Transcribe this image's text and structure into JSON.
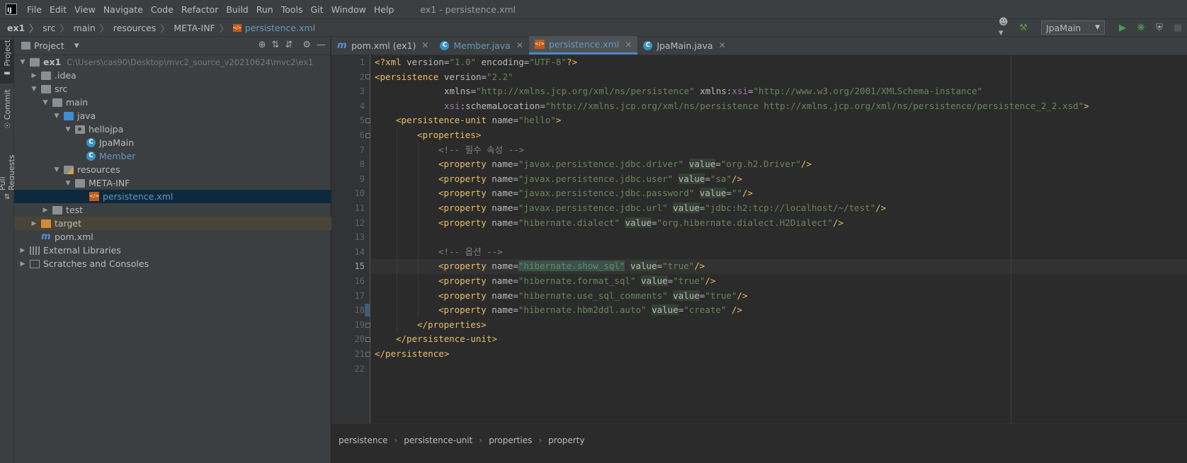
{
  "menubar": {
    "logo": "IJ",
    "items": [
      "File",
      "Edit",
      "View",
      "Navigate",
      "Code",
      "Refactor",
      "Build",
      "Run",
      "Tools",
      "Git",
      "Window",
      "Help"
    ],
    "window_title": "ex1 - persistence.xml"
  },
  "breadcrumbs": [
    "ex1",
    "src",
    "main",
    "resources",
    "META-INF",
    "persistence.xml"
  ],
  "toolbar": {
    "run_config": "JpaMain"
  },
  "left_strip": {
    "project": "Project",
    "commit": "Commit",
    "pull_requests": "Pull Requests"
  },
  "project_panel": {
    "title": "Project",
    "tree": [
      {
        "label": "ex1",
        "path": "C:\\Users\\cas90\\Desktop\\mvc2_source_v20210624\\mvc2\\ex1"
      },
      {
        "label": ".idea"
      },
      {
        "label": "src"
      },
      {
        "label": "main"
      },
      {
        "label": "java"
      },
      {
        "label": "hellojpa"
      },
      {
        "label": "JpaMain"
      },
      {
        "label": "Member"
      },
      {
        "label": "resources"
      },
      {
        "label": "META-INF"
      },
      {
        "label": "persistence.xml"
      },
      {
        "label": "test"
      },
      {
        "label": "target"
      },
      {
        "label": "pom.xml"
      },
      {
        "label": "External Libraries"
      },
      {
        "label": "Scratches and Consoles"
      }
    ]
  },
  "tabs": [
    {
      "label": "pom.xml (ex1)",
      "icon": "m"
    },
    {
      "label": "Member.java",
      "icon": "C"
    },
    {
      "label": "persistence.xml",
      "icon": "xml"
    },
    {
      "label": "JpaMain.java",
      "icon": "C"
    }
  ],
  "code": {
    "line_numbers": [
      "1",
      "2",
      "3",
      "4",
      "5",
      "6",
      "7",
      "8",
      "9",
      "10",
      "11",
      "12",
      "13",
      "14",
      "15",
      "16",
      "17",
      "18",
      "19",
      "20",
      "21",
      "22"
    ],
    "current_line": "15",
    "l1": {
      "a": "<?xml ",
      "b": "version",
      "c": "=",
      "d": "\"1.0\"",
      "e": " encoding",
      "f": "=",
      "g": "\"UTF-8\"",
      "h": "?>"
    },
    "l2": {
      "a": "<persistence ",
      "b": "version",
      "c": "=",
      "d": "\"2.2\""
    },
    "l3": {
      "a": "xmlns",
      "b": "=",
      "c": "\"http://xmlns.jcp.org/xml/ns/persistence\"",
      "d": " xmlns:",
      "e": "xsi",
      "f": "=",
      "g": "\"http://www.w3.org/2001/XMLSchema-instance\""
    },
    "l4": {
      "a": "xsi",
      "b": ":schemaLocation",
      "c": "=",
      "d": "\"http://xmlns.jcp.org/xml/ns/persistence http://xmlns.jcp.org/xml/ns/persistence/persistence_2_2.xsd\"",
      "e": ">"
    },
    "l5": {
      "a": "<persistence-unit ",
      "b": "name",
      "c": "=",
      "d": "\"hello\"",
      "e": ">"
    },
    "l6": "<properties>",
    "l7": "<!-- 필수 속성 -->",
    "l13": "",
    "l14": "<!-- 옵션 -->",
    "props": [
      {
        "name": "\"javax.persistence.jdbc.driver\"",
        "value": "\"org.h2.Driver\"",
        "end": "/>"
      },
      {
        "name": "\"javax.persistence.jdbc.user\"",
        "value": "\"sa\"",
        "end": "/>"
      },
      {
        "name": "\"javax.persistence.jdbc.password\"",
        "value": "\"\"",
        "end": "/>"
      },
      {
        "name": "\"javax.persistence.jdbc.url\"",
        "value": "\"jdbc:h2:tcp://localhost/~/test\"",
        "end": "/>"
      },
      {
        "name": "\"hibernate.dialect\"",
        "value": "\"org.hibernate.dialect.H2Dialect\"",
        "end": "/>"
      },
      {
        "name": "\"hibernate.show_sql\"",
        "value": "\"true\"",
        "end": "/>"
      },
      {
        "name": "\"hibernate.format_sql\"",
        "value": "\"true\"",
        "end": "/>"
      },
      {
        "name": "\"hibernate.use_sql_comments\"",
        "value": "\"true\"",
        "end": "/>"
      },
      {
        "name": "\"hibernate.hbm2ddl.auto\"",
        "value": "\"create\"",
        "end": " />"
      }
    ],
    "prop_open": "<property ",
    "prop_name_attr": "name",
    "prop_value_attr": "value",
    "eq": "=",
    "l19": "</properties>",
    "l20": "</persistence-unit>",
    "l21": "</persistence>"
  },
  "bottom_breadcrumbs": [
    "persistence",
    "persistence-unit",
    "properties",
    "property"
  ]
}
